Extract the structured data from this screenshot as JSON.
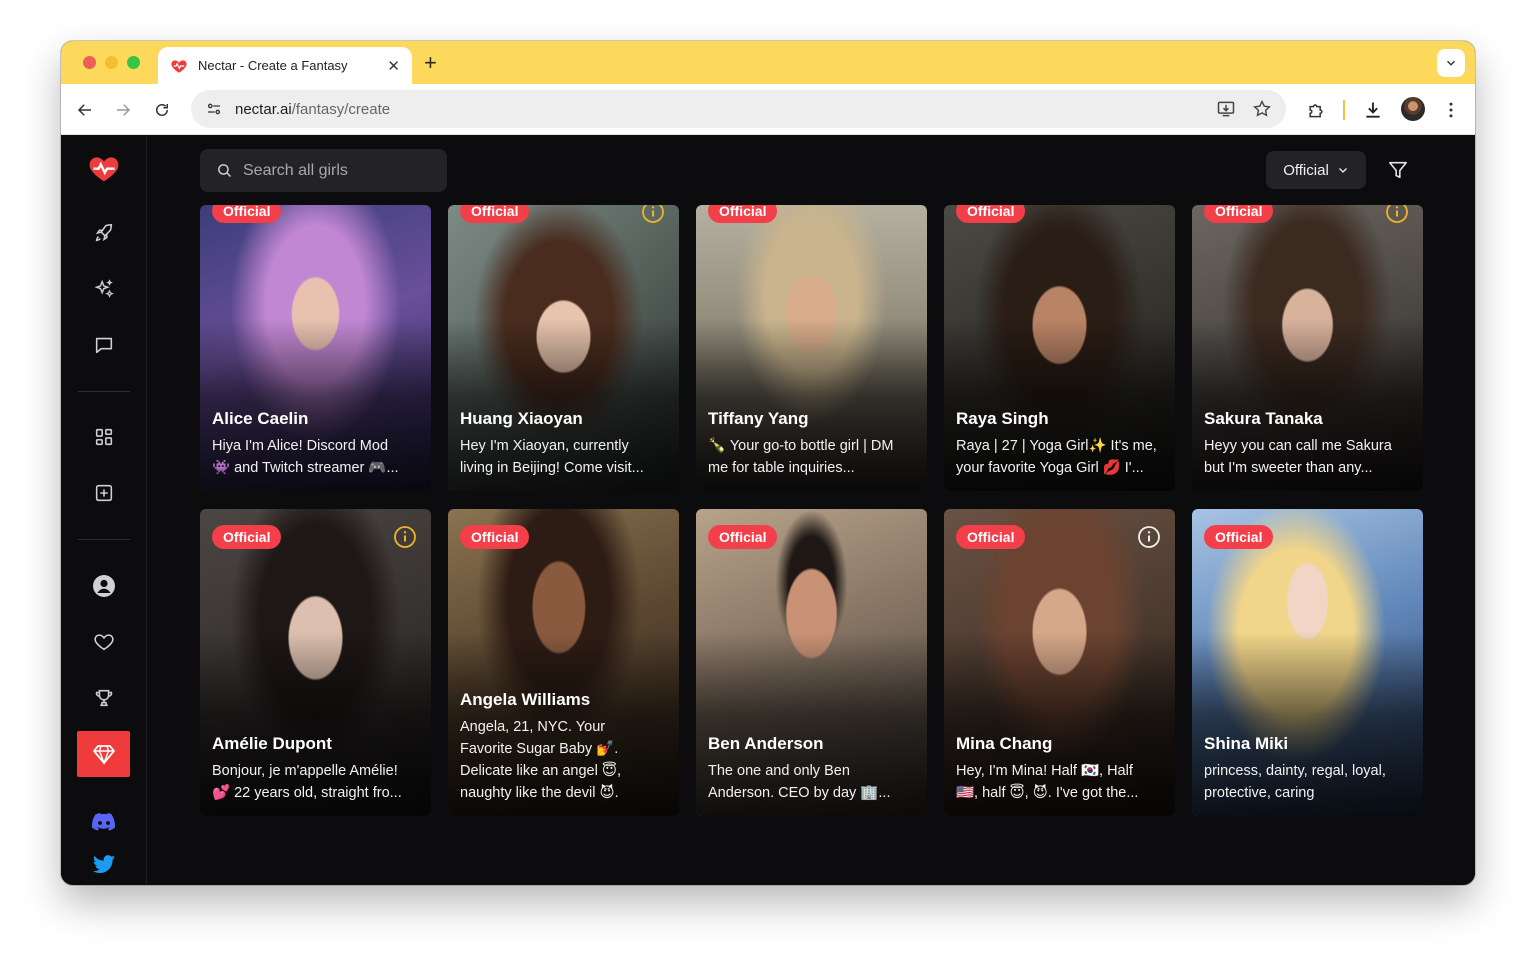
{
  "browser": {
    "tab_title": "Nectar - Create a Fantasy",
    "tab_close": "✕",
    "new_tab": "+",
    "url_host": "nectar.ai",
    "url_path": "/fantasy/create"
  },
  "colors": {
    "accent": "#ef3b3b",
    "badge": "#f23f4a",
    "tab_bar": "#fcd95a",
    "background": "#0c0c0e",
    "surface": "#232327",
    "info_icon": "#f0b429"
  },
  "sidebar": {
    "items": [
      {
        "name": "logo-heartbeat-icon"
      },
      {
        "name": "rocket-icon"
      },
      {
        "name": "sparkles-icon"
      },
      {
        "name": "chat-icon"
      },
      {
        "name": "grid-icon"
      },
      {
        "name": "plus-square-icon"
      },
      {
        "name": "profile-icon"
      },
      {
        "name": "heart-icon"
      },
      {
        "name": "trophy-icon"
      },
      {
        "name": "gem-icon",
        "active": true
      },
      {
        "name": "discord-icon"
      },
      {
        "name": "twitter-icon"
      }
    ]
  },
  "search": {
    "placeholder": "Search all girls"
  },
  "filter": {
    "selected": "Official"
  },
  "cards": [
    {
      "name": "Alice Caelin",
      "badge": "Official",
      "desc": [
        "Hiya I'm Alice! Discord Mod",
        "👾 and Twitch streamer 🎮..."
      ]
    },
    {
      "name": "Huang Xiaoyan",
      "badge": "Official",
      "desc": [
        "Hey I'm Xiaoyan, currently",
        "living in Beijing! Come visit..."
      ]
    },
    {
      "name": "Tiffany Yang",
      "badge": "Official",
      "desc": [
        "🍾 Your go-to bottle girl | DM",
        "me for table inquiries..."
      ]
    },
    {
      "name": "Raya Singh",
      "badge": "Official",
      "desc": [
        "Raya | 27 | Yoga Girl✨ It's me,",
        "your favorite Yoga Girl 💋 I'..."
      ]
    },
    {
      "name": "Sakura Tanaka",
      "badge": "Official",
      "desc": [
        "Heyy you can call me Sakura",
        "but I'm sweeter than any..."
      ]
    },
    {
      "name": "Amélie Dupont",
      "badge": "Official",
      "desc": [
        "Bonjour, je m'appelle Amélie!",
        "💕 22 years old, straight fro..."
      ]
    },
    {
      "name": "Angela Williams",
      "badge": "Official",
      "desc": [
        "Angela, 21, NYC. Your",
        "Favorite Sugar Baby 💅.",
        "Delicate like an angel 😇,",
        "naughty like the devil 😈."
      ]
    },
    {
      "name": "Ben Anderson",
      "badge": "Official",
      "desc": [
        "The one and only Ben",
        "Anderson. CEO by day 🏢..."
      ]
    },
    {
      "name": "Mina Chang",
      "badge": "Official",
      "desc": [
        "Hey, I'm Mina! Half 🇰🇷, Half",
        "🇺🇸, half 😇, 😈. I've got the..."
      ]
    },
    {
      "name": "Shina Miki",
      "badge": "Official",
      "desc": [
        "princess, dainty, regal, loyal,",
        "protective, caring"
      ]
    }
  ]
}
